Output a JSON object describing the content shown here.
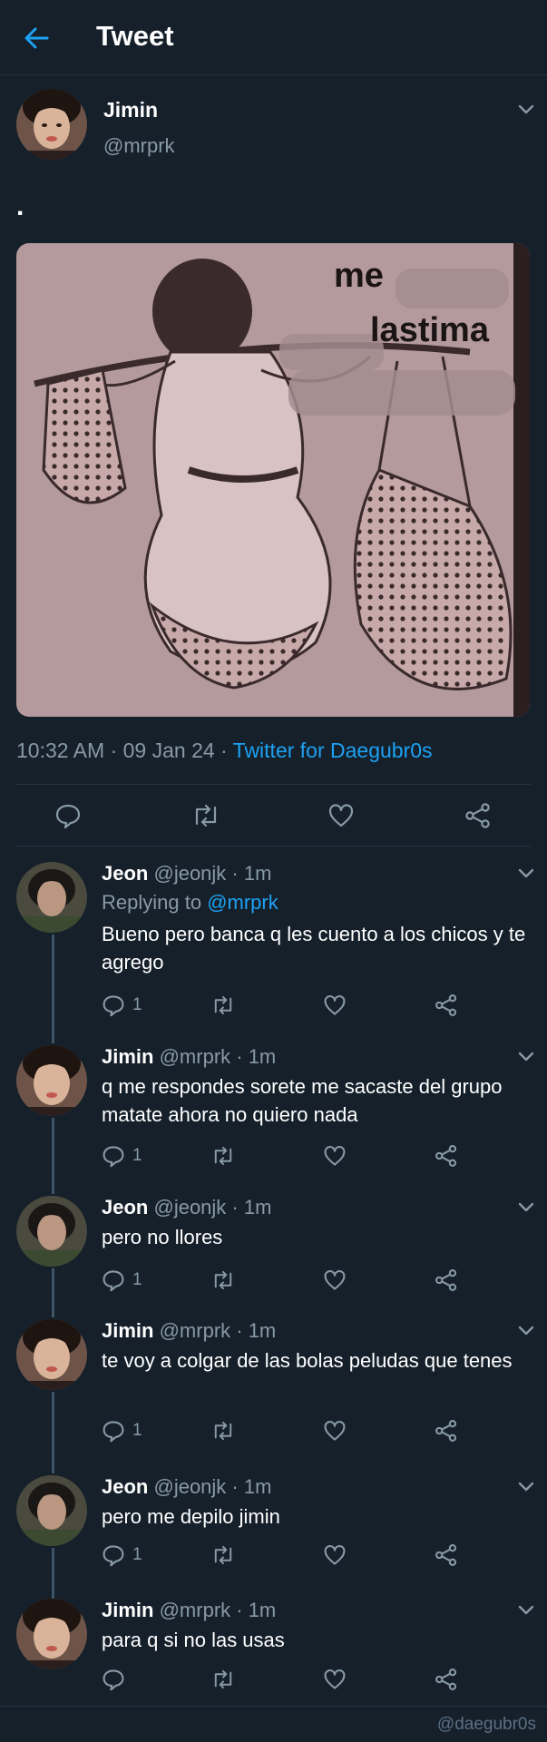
{
  "header": {
    "title": "Tweet"
  },
  "main_tweet": {
    "author": "Jimin",
    "handle": "@mrprk",
    "text": ".",
    "meme_caption_1": "me",
    "meme_caption_2": "lastima",
    "time": "10:32 AM · 09 Jan 24 · ",
    "source": "Twitter for Daegubr0s"
  },
  "replying_label": "Replying to ",
  "replies": [
    {
      "author": "Jeon",
      "meta": "@jeonjk · 1m",
      "replying_to": "@mrprk",
      "text": "Bueno pero banca q les cuento a los chicos y te agrego",
      "reply_count": "1"
    },
    {
      "author": "Jimin",
      "meta": "@mrprk · 1m",
      "text": "q me respondes sorete me sacaste del grupo matate ahora no quiero nada",
      "reply_count": "1"
    },
    {
      "author": "Jeon",
      "meta": "@jeonjk · 1m",
      "text": "pero no llores",
      "reply_count": "1"
    },
    {
      "author": "Jimin",
      "meta": "@mrprk · 1m",
      "text": "te voy a colgar de las bolas peludas que tenes",
      "reply_count": "1"
    },
    {
      "author": "Jeon",
      "meta": "@jeonjk · 1m",
      "text": "pero me depilo jimin",
      "reply_count": "1"
    },
    {
      "author": "Jimin",
      "meta": "@mrprk · 1m",
      "text": "para q si no las usas",
      "reply_count": ""
    }
  ],
  "watermark": "@daegubr0s",
  "icons": [
    "back-arrow-icon",
    "chevron-down-icon",
    "reply-icon",
    "retweet-icon",
    "like-icon",
    "share-icon"
  ],
  "colors": {
    "background": "#15202b",
    "accent": "#1da1f2",
    "secondary_text": "#8899a6",
    "divider": "#253341"
  }
}
